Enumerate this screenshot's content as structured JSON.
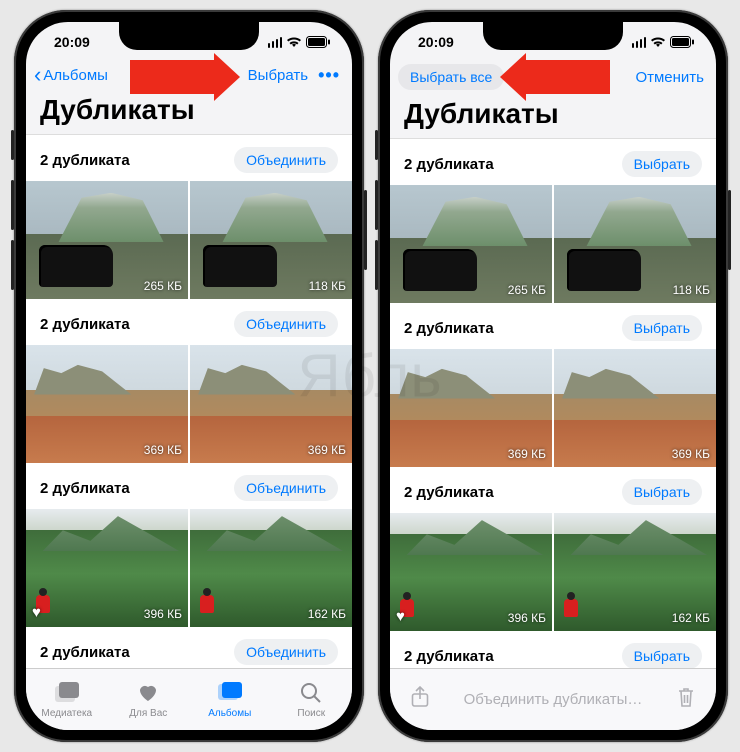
{
  "watermark": "Ябль",
  "status": {
    "time": "20:09"
  },
  "phone1": {
    "nav": {
      "back_label": "Альбомы",
      "select_label": "Выбрать",
      "more_label": "•••"
    },
    "title": "Дубликаты",
    "groups": [
      {
        "title": "2 дубликата",
        "action": "Объединить",
        "sizes": [
          "265 КБ",
          "118 КБ"
        ],
        "scene": "car"
      },
      {
        "title": "2 дубликата",
        "action": "Объединить",
        "sizes": [
          "369 КБ",
          "369 КБ"
        ],
        "scene": "town"
      },
      {
        "title": "2 дубликата",
        "action": "Объединить",
        "sizes": [
          "396 КБ",
          "162 КБ"
        ],
        "scene": "green",
        "fav_first": true
      },
      {
        "title": "2 дубликата",
        "action": "Объединить",
        "sizes": [
          "",
          ""
        ],
        "scene": "sky",
        "short": true
      }
    ],
    "tabs": [
      {
        "label": "Медиатека",
        "active": false
      },
      {
        "label": "Для Вас",
        "active": false
      },
      {
        "label": "Альбомы",
        "active": true
      },
      {
        "label": "Поиск",
        "active": false
      }
    ]
  },
  "phone2": {
    "nav": {
      "select_all_label": "Выбрать все",
      "cancel_label": "Отменить"
    },
    "title": "Дубликаты",
    "groups": [
      {
        "title": "2 дубликата",
        "action": "Выбрать",
        "sizes": [
          "265 КБ",
          "118 КБ"
        ],
        "scene": "car"
      },
      {
        "title": "2 дубликата",
        "action": "Выбрать",
        "sizes": [
          "369 КБ",
          "369 КБ"
        ],
        "scene": "town"
      },
      {
        "title": "2 дубликата",
        "action": "Выбрать",
        "sizes": [
          "396 КБ",
          "162 КБ"
        ],
        "scene": "green",
        "fav_first": true
      },
      {
        "title": "2 дубликата",
        "action": "Выбрать",
        "sizes": [
          "",
          ""
        ],
        "scene": "sky",
        "short": true
      }
    ],
    "toolbar": {
      "merge_label": "Объединить дубликаты…"
    }
  }
}
